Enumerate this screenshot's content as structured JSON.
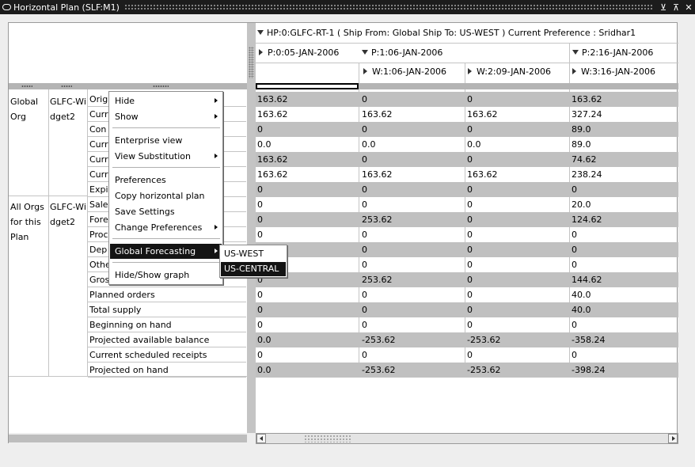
{
  "window": {
    "title": "Horizontal Plan (SLF:M1)"
  },
  "plan_header": {
    "label": "HP:0:GLFC-RT-1  ( Ship From: Global  Ship To: US-WEST )   Current Preference : Sridhar1",
    "periods": [
      {
        "label": "P:0:05-JAN-2006"
      },
      {
        "label": "P:1:06-JAN-2006"
      },
      {
        "label": "P:2:16-JAN-2006"
      }
    ],
    "weeks": [
      {
        "label": "W:1:06-JAN-2006"
      },
      {
        "label": "W:2:09-JAN-2006"
      },
      {
        "label": "W:3:16-JAN-2006"
      }
    ]
  },
  "orgs": [
    {
      "org": "Global Org",
      "item": "GLFC-Widget2"
    },
    {
      "org": "All Orgs for this Plan",
      "item": "GLFC-Widget2"
    }
  ],
  "rows": [
    {
      "label": "Orig",
      "values": [
        "163.62",
        "0",
        "0",
        "163.62"
      ]
    },
    {
      "label": "Curr",
      "values": [
        "163.62",
        "163.62",
        "163.62",
        "327.24"
      ]
    },
    {
      "label": "Con",
      "values": [
        "0",
        "0",
        "0",
        "89.0"
      ]
    },
    {
      "label": "Curr",
      "values": [
        "0.0",
        "0.0",
        "0.0",
        "89.0"
      ]
    },
    {
      "label": "Curr",
      "values": [
        "163.62",
        "0",
        "0",
        "74.62"
      ]
    },
    {
      "label": "Curr",
      "values": [
        "163.62",
        "163.62",
        "163.62",
        "238.24"
      ]
    },
    {
      "label": "Expi",
      "values": [
        "0",
        "0",
        "0",
        "0"
      ]
    },
    {
      "label": "Sale",
      "values": [
        "0",
        "0",
        "0",
        "20.0"
      ]
    },
    {
      "label": "Fore",
      "values": [
        "0",
        "253.62",
        "0",
        "124.62"
      ]
    },
    {
      "label": "Proc",
      "values": [
        "0",
        "0",
        "0",
        "0"
      ]
    },
    {
      "label": "Dep",
      "values": [
        "0",
        "0",
        "0",
        "0"
      ]
    },
    {
      "label": "Othe",
      "values": [
        "0",
        "0",
        "0",
        "0"
      ]
    },
    {
      "label": "Gros",
      "values": [
        "0",
        "253.62",
        "0",
        "144.62"
      ]
    },
    {
      "label": "Planned orders",
      "values": [
        "0",
        "0",
        "0",
        "40.0"
      ]
    },
    {
      "label": "Total supply",
      "values": [
        "0",
        "0",
        "0",
        "40.0"
      ]
    },
    {
      "label": "Beginning on hand",
      "values": [
        "0",
        "0",
        "0",
        "0"
      ]
    },
    {
      "label": "Projected available balance",
      "values": [
        "0.0",
        "-253.62",
        "-253.62",
        "-358.24"
      ]
    },
    {
      "label": "Current scheduled receipts",
      "values": [
        "0",
        "0",
        "0",
        "0"
      ]
    },
    {
      "label": "Projected on hand",
      "values": [
        "0.0",
        "-253.62",
        "-253.62",
        "-398.24"
      ]
    }
  ],
  "context_menu": {
    "items": [
      {
        "label": "Hide",
        "submenu": true
      },
      {
        "label": "Show",
        "submenu": true
      },
      {
        "label": "Enterprise view",
        "submenu": false
      },
      {
        "label": "View Substitution",
        "submenu": true
      },
      {
        "label": "Preferences",
        "submenu": false
      },
      {
        "label": "Copy horizontal plan",
        "submenu": false
      },
      {
        "label": "Save Settings",
        "submenu": false
      },
      {
        "label": "Change Preferences",
        "submenu": true
      },
      {
        "label": "Global Forecasting",
        "submenu": true
      },
      {
        "label": "Hide/Show graph",
        "submenu": false
      }
    ],
    "selected": "Global Forecasting"
  },
  "submenu": {
    "items": [
      {
        "label": "US-WEST"
      },
      {
        "label": "US-CENTRAL"
      }
    ],
    "selected": "US-CENTRAL"
  },
  "window_buttons": {
    "minimize": "⊻",
    "restore": "⊼",
    "close": "✕"
  }
}
